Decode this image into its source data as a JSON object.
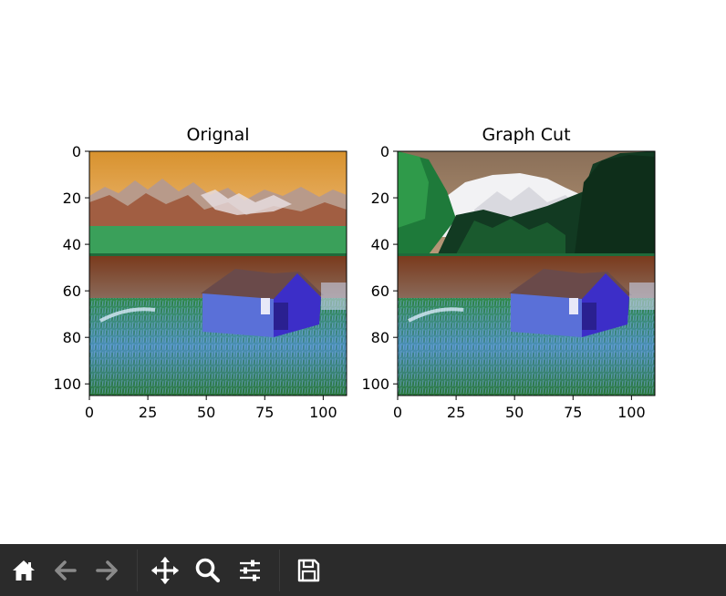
{
  "chart_data": [
    {
      "type": "image",
      "title": "Orignal",
      "xticks": [
        "0",
        "25",
        "50",
        "75",
        "100"
      ],
      "yticks": [
        "0",
        "20",
        "40",
        "60",
        "80",
        "100"
      ],
      "xlim": [
        0,
        110
      ],
      "ylim": [
        105,
        0
      ],
      "grid": false
    },
    {
      "type": "image",
      "title": "Graph Cut",
      "xticks": [
        "0",
        "25",
        "50",
        "75",
        "100"
      ],
      "yticks": [
        "0",
        "20",
        "40",
        "60",
        "80",
        "100"
      ],
      "xlim": [
        0,
        110
      ],
      "ylim": [
        105,
        0
      ],
      "grid": false
    }
  ],
  "toolbar": {
    "buttons": [
      {
        "icon": "home-icon",
        "name": "home-button"
      },
      {
        "icon": "back-arrow-icon",
        "name": "back-button"
      },
      {
        "icon": "forward-arrow-icon",
        "name": "forward-button"
      },
      {
        "icon": "pan-move-icon",
        "name": "pan-button"
      },
      {
        "icon": "zoom-magnifier-icon",
        "name": "zoom-button"
      },
      {
        "icon": "sliders-icon",
        "name": "configure-subplots-button"
      },
      {
        "icon": "save-floppy-icon",
        "name": "save-button"
      }
    ]
  }
}
